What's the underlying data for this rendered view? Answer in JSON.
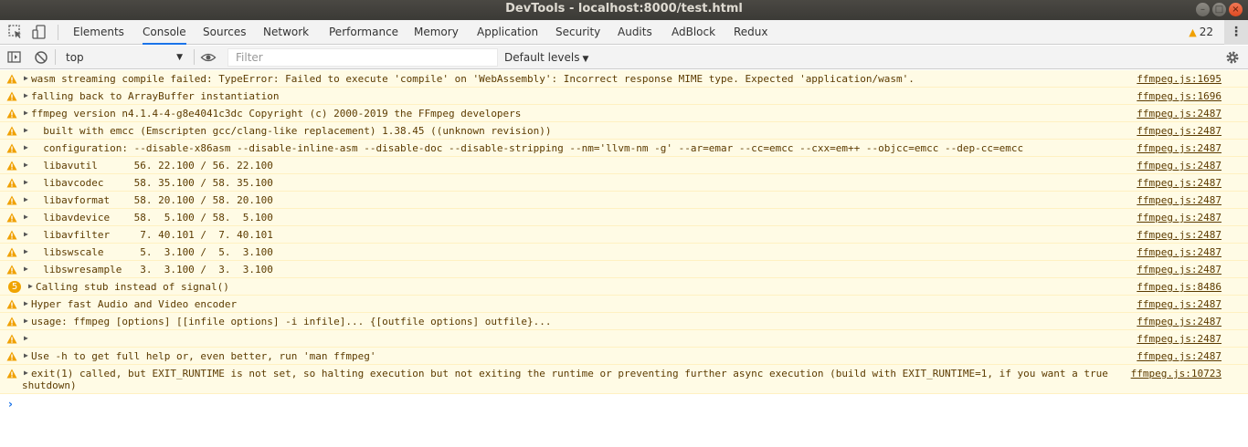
{
  "window": {
    "title": "DevTools - localhost:8000/test.html"
  },
  "tabs": [
    {
      "label": "Elements"
    },
    {
      "label": "Console",
      "active": true
    },
    {
      "label": "Sources"
    },
    {
      "label": "Network"
    },
    {
      "label": "Performance"
    },
    {
      "label": "Memory"
    },
    {
      "label": "Application"
    },
    {
      "label": "Security"
    },
    {
      "label": "Audits"
    },
    {
      "label": "AdBlock"
    },
    {
      "label": "Redux"
    }
  ],
  "warnings_count": "22",
  "toolbar": {
    "context": "top",
    "filter_placeholder": "Filter",
    "levels_label": "Default levels"
  },
  "colors": {
    "warning_bg": "#fffbe5",
    "warning_text": "#5c3b00",
    "warning_icon": "#f0a000",
    "active_tab_accent": "#1a73e8"
  },
  "messages": [
    {
      "text": "wasm streaming compile failed: TypeError: Failed to execute 'compile' on 'WebAssembly': Incorrect response MIME type. Expected 'application/wasm'.",
      "source": "ffmpeg.js:1695"
    },
    {
      "text": "falling back to ArrayBuffer instantiation",
      "source": "ffmpeg.js:1696"
    },
    {
      "text": "ffmpeg version n4.1.4-4-g8e4041c3dc Copyright (c) 2000-2019 the FFmpeg developers",
      "source": "ffmpeg.js:2487"
    },
    {
      "text": "  built with emcc (Emscripten gcc/clang-like replacement) 1.38.45 ((unknown revision))",
      "source": "ffmpeg.js:2487"
    },
    {
      "text": "  configuration: --disable-x86asm --disable-inline-asm --disable-doc --disable-stripping --nm='llvm-nm -g' --ar=emar --cc=emcc --cxx=em++ --objcc=emcc --dep-cc=emcc",
      "source": "ffmpeg.js:2487"
    },
    {
      "text": "  libavutil      56. 22.100 / 56. 22.100",
      "source": "ffmpeg.js:2487"
    },
    {
      "text": "  libavcodec     58. 35.100 / 58. 35.100",
      "source": "ffmpeg.js:2487"
    },
    {
      "text": "  libavformat    58. 20.100 / 58. 20.100",
      "source": "ffmpeg.js:2487"
    },
    {
      "text": "  libavdevice    58.  5.100 / 58.  5.100",
      "source": "ffmpeg.js:2487"
    },
    {
      "text": "  libavfilter     7. 40.101 /  7. 40.101",
      "source": "ffmpeg.js:2487"
    },
    {
      "text": "  libswscale      5.  3.100 /  5.  3.100",
      "source": "ffmpeg.js:2487"
    },
    {
      "text": "  libswresample   3.  3.100 /  3.  3.100",
      "source": "ffmpeg.js:2487"
    },
    {
      "text": "Calling stub instead of signal()",
      "source": "ffmpeg.js:8486",
      "count": "5"
    },
    {
      "text": "Hyper fast Audio and Video encoder",
      "source": "ffmpeg.js:2487"
    },
    {
      "text": "usage: ffmpeg [options] [[infile options] -i infile]... {[outfile options] outfile}...",
      "source": "ffmpeg.js:2487"
    },
    {
      "text": "",
      "source": "ffmpeg.js:2487"
    },
    {
      "text": "Use -h to get full help or, even better, run 'man ffmpeg'",
      "source": "ffmpeg.js:2487"
    },
    {
      "text": "exit(1) called, but EXIT_RUNTIME is not set, so halting execution but not exiting the runtime or preventing further async execution (build with EXIT_RUNTIME=1, if you want a true shutdown)",
      "source": "ffmpeg.js:10723",
      "tall": true
    }
  ]
}
